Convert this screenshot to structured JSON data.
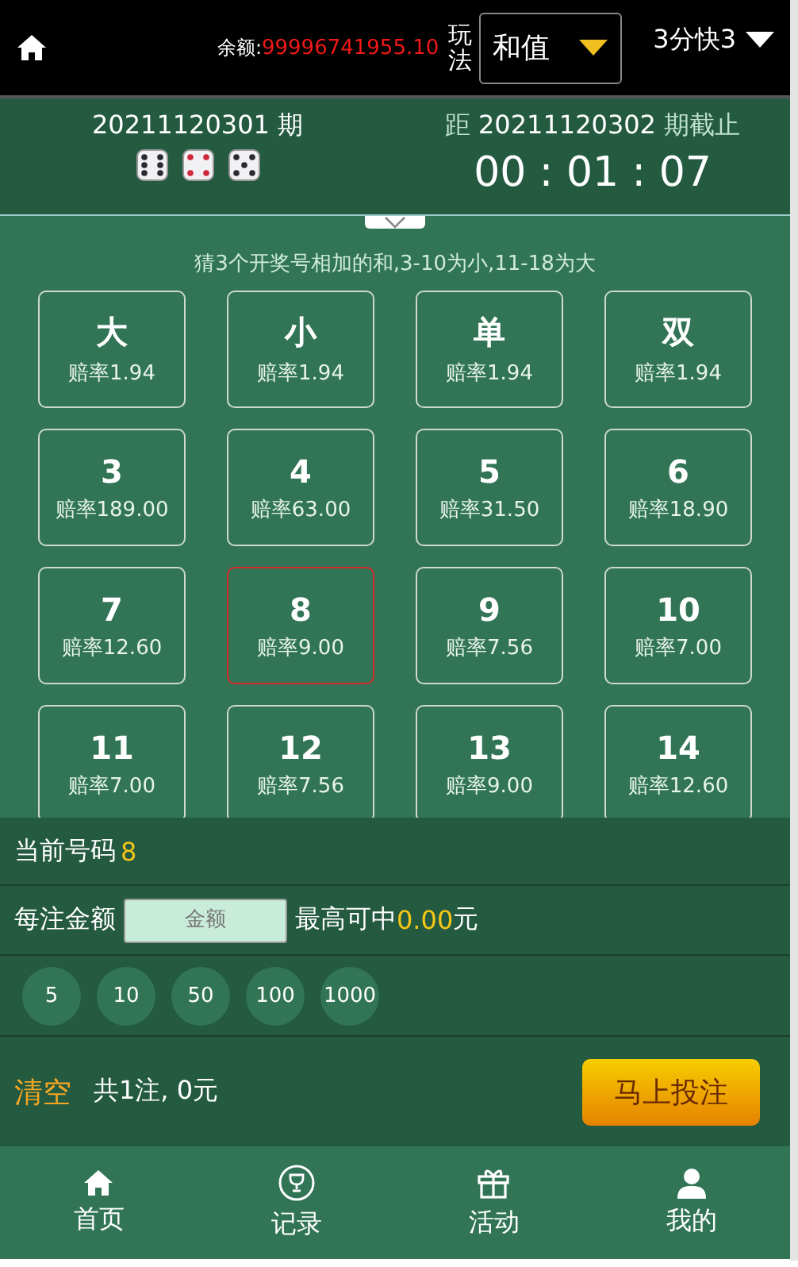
{
  "header": {
    "balance_label": "余额:",
    "balance": "99996741955.10",
    "play_label": "玩法",
    "play_select": "和值",
    "lottery_select": "3分快3"
  },
  "draw": {
    "current_issue": "20211120301 期",
    "dice": [
      {
        "kind": "six"
      },
      {
        "kind": "four"
      },
      {
        "kind": "five"
      }
    ],
    "next_prefix": "距",
    "next_issue": "20211120302",
    "next_suffix": "期截止",
    "countdown": "00 : 01 : 07"
  },
  "rule_text": "猜3个开奖号相加的和,3-10为小,11-18为大",
  "bets": [
    {
      "name": "大",
      "odds": "赔率1.94",
      "selected": false
    },
    {
      "name": "小",
      "odds": "赔率1.94",
      "selected": false
    },
    {
      "name": "单",
      "odds": "赔率1.94",
      "selected": false
    },
    {
      "name": "双",
      "odds": "赔率1.94",
      "selected": false
    },
    {
      "name": "3",
      "odds": "赔率189.00",
      "selected": false
    },
    {
      "name": "4",
      "odds": "赔率63.00",
      "selected": false
    },
    {
      "name": "5",
      "odds": "赔率31.50",
      "selected": false
    },
    {
      "name": "6",
      "odds": "赔率18.90",
      "selected": false
    },
    {
      "name": "7",
      "odds": "赔率12.60",
      "selected": false
    },
    {
      "name": "8",
      "odds": "赔率9.00",
      "selected": true
    },
    {
      "name": "9",
      "odds": "赔率7.56",
      "selected": false
    },
    {
      "name": "10",
      "odds": "赔率7.00",
      "selected": false
    },
    {
      "name": "11",
      "odds": "赔率7.00",
      "selected": false
    },
    {
      "name": "12",
      "odds": "赔率7.56",
      "selected": false
    },
    {
      "name": "13",
      "odds": "赔率9.00",
      "selected": false
    },
    {
      "name": "14",
      "odds": "赔率12.60",
      "selected": false
    }
  ],
  "current_number": {
    "label": "当前号码",
    "value": "8"
  },
  "amount": {
    "label": "每注金额",
    "placeholder": "金额",
    "max_label": "最高可中",
    "max_value": "0.00",
    "unit": "元"
  },
  "chips": [
    "5",
    "10",
    "50",
    "100",
    "1000"
  ],
  "summary": {
    "clear": "清空",
    "total": "共1注, 0元",
    "submit": "马上投注"
  },
  "tabbar": [
    {
      "label": "首页"
    },
    {
      "label": "记录"
    },
    {
      "label": "活动"
    },
    {
      "label": "我的"
    }
  ]
}
